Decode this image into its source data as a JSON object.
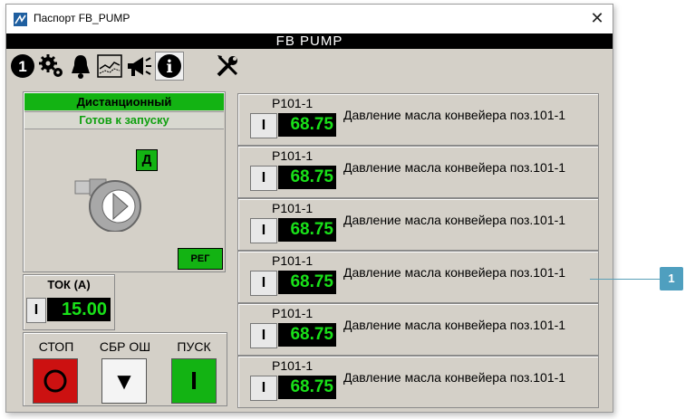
{
  "window": {
    "title": "Паспорт FB_PUMP",
    "close_glyph": "✕"
  },
  "header": {
    "title": "FB  PUMP"
  },
  "toolbar": {
    "buttons": [
      {
        "name": "info-number-icon",
        "glyph": "1"
      },
      {
        "name": "settings-gears-icon"
      },
      {
        "name": "alarm-bell-icon"
      },
      {
        "name": "trend-chart-icon"
      },
      {
        "name": "megaphone-icon"
      },
      {
        "name": "info-icon",
        "glyph": "i",
        "active": true
      },
      {
        "name": "tools-icon"
      }
    ]
  },
  "pump": {
    "mode": "Дистанционный",
    "status": "Готов к запуску",
    "badge": "Д",
    "reg_button": "РЕГ",
    "current": {
      "label": "ТОК (А)",
      "indicator": "I",
      "value": "15.00"
    }
  },
  "commands": {
    "stop_label": "СТОП",
    "reset_label": "СБР ОШ",
    "start_label": "ПУСК",
    "start_glyph": "I",
    "reset_glyph": "▼"
  },
  "sensors": [
    {
      "tag": "P101-1",
      "indicator": "I",
      "value": "68.75",
      "desc": "Давление масла конвейера поз.101-1"
    },
    {
      "tag": "P101-1",
      "indicator": "I",
      "value": "68.75",
      "desc": "Давление масла конвейера поз.101-1"
    },
    {
      "tag": "P101-1",
      "indicator": "I",
      "value": "68.75",
      "desc": "Давление масла конвейера поз.101-1"
    },
    {
      "tag": "P101-1",
      "indicator": "I",
      "value": "68.75",
      "desc": "Давление масла конвейера поз.101-1"
    },
    {
      "tag": "P101-1",
      "indicator": "I",
      "value": "68.75",
      "desc": "Давление масла конвейера поз.101-1"
    },
    {
      "tag": "P101-1",
      "indicator": "I",
      "value": "68.75",
      "desc": "Давление масла конвейера поз.101-1"
    }
  ],
  "callout": {
    "number": "1"
  },
  "colors": {
    "ok_green": "#13b313",
    "value_green": "#19e119",
    "stop_red": "#cc1111",
    "panel_gray": "#d4d0c8",
    "callout_blue": "#4f9fbf"
  }
}
